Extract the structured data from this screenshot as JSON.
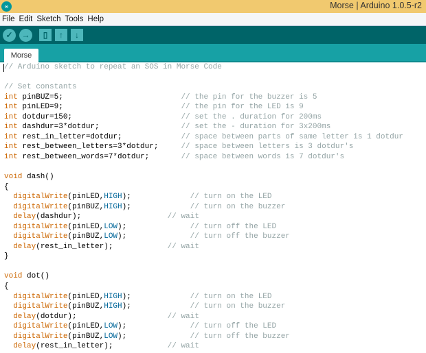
{
  "window": {
    "title": "Morse | Arduino 1.0.5-r2",
    "logo": "arduino-logo"
  },
  "menu": [
    "File",
    "Edit",
    "Sketch",
    "Tools",
    "Help"
  ],
  "toolbar": {
    "verify": "check-icon",
    "upload": "arrow-right-icon",
    "new": "new-file-icon",
    "open": "arrow-up-icon",
    "save": "arrow-down-icon"
  },
  "tabs": [
    {
      "label": "Morse"
    }
  ],
  "colors": {
    "titlebar": "#f1c96f",
    "toolbar": "#006468",
    "tabbar": "#17a1a5",
    "keyword": "#cc6600",
    "constant": "#006699",
    "comment": "#95a5a6"
  },
  "code": [
    [
      [
        "// Arduino sketch to repeat an SOS in Morse Code",
        "cm"
      ]
    ],
    [],
    [
      [
        "// Set constants",
        "cm"
      ]
    ],
    [
      [
        "int",
        "k"
      ],
      [
        " pinBUZ=5;                          "
      ],
      [
        "// the pin for the buzzer is 5",
        "cm"
      ]
    ],
    [
      [
        "int",
        "k"
      ],
      [
        " pinLED=9;                          "
      ],
      [
        "// the pin for the LED is 9",
        "cm"
      ]
    ],
    [
      [
        "int",
        "k"
      ],
      [
        " dotdur=150;                        "
      ],
      [
        "// set the . duration for 200ms",
        "cm"
      ]
    ],
    [
      [
        "int",
        "k"
      ],
      [
        " dashdur=3*dotdur;                  "
      ],
      [
        "// set the - duration for 3x200ms",
        "cm"
      ]
    ],
    [
      [
        "int",
        "k"
      ],
      [
        " rest_in_letter=dotdur;             "
      ],
      [
        "// space between parts of same letter is 1 dotdur",
        "cm"
      ]
    ],
    [
      [
        "int",
        "k"
      ],
      [
        " rest_between_letters=3*dotdur;     "
      ],
      [
        "// space between letters is 3 dotdur's",
        "cm"
      ]
    ],
    [
      [
        "int",
        "k"
      ],
      [
        " rest_between_words=7*dotdur;       "
      ],
      [
        "// space between words is 7 dotdur's",
        "cm"
      ]
    ],
    [],
    [
      [
        "void",
        "k"
      ],
      [
        " dash()"
      ]
    ],
    [
      [
        "{"
      ]
    ],
    [
      [
        "  "
      ],
      [
        "digitalWrite",
        "f"
      ],
      [
        "(pinLED,"
      ],
      [
        "HIGH",
        "c2"
      ],
      [
        ");             "
      ],
      [
        "// turn on the LED",
        "cm"
      ]
    ],
    [
      [
        "  "
      ],
      [
        "digitalWrite",
        "f"
      ],
      [
        "(pinBUZ,"
      ],
      [
        "HIGH",
        "c2"
      ],
      [
        ");             "
      ],
      [
        "// turn on the buzzer",
        "cm"
      ]
    ],
    [
      [
        "  "
      ],
      [
        "delay",
        "f"
      ],
      [
        "(dashdur);                   "
      ],
      [
        "// wait",
        "cm"
      ]
    ],
    [
      [
        "  "
      ],
      [
        "digitalWrite",
        "f"
      ],
      [
        "(pinLED,"
      ],
      [
        "LOW",
        "c2"
      ],
      [
        ");              "
      ],
      [
        "// turn off the LED",
        "cm"
      ]
    ],
    [
      [
        "  "
      ],
      [
        "digitalWrite",
        "f"
      ],
      [
        "(pinBUZ,"
      ],
      [
        "LOW",
        "c2"
      ],
      [
        ");              "
      ],
      [
        "// turn off the buzzer",
        "cm"
      ]
    ],
    [
      [
        "  "
      ],
      [
        "delay",
        "f"
      ],
      [
        "(rest_in_letter);            "
      ],
      [
        "// wait",
        "cm"
      ]
    ],
    [
      [
        "}"
      ]
    ],
    [],
    [
      [
        "void",
        "k"
      ],
      [
        " dot()"
      ]
    ],
    [
      [
        "{"
      ]
    ],
    [
      [
        "  "
      ],
      [
        "digitalWrite",
        "f"
      ],
      [
        "(pinLED,"
      ],
      [
        "HIGH",
        "c2"
      ],
      [
        ");             "
      ],
      [
        "// turn on the LED",
        "cm"
      ]
    ],
    [
      [
        "  "
      ],
      [
        "digitalWrite",
        "f"
      ],
      [
        "(pinBUZ,"
      ],
      [
        "HIGH",
        "c2"
      ],
      [
        ");             "
      ],
      [
        "// turn on the buzzer",
        "cm"
      ]
    ],
    [
      [
        "  "
      ],
      [
        "delay",
        "f"
      ],
      [
        "(dotdur);                    "
      ],
      [
        "// wait",
        "cm"
      ]
    ],
    [
      [
        "  "
      ],
      [
        "digitalWrite",
        "f"
      ],
      [
        "(pinLED,"
      ],
      [
        "LOW",
        "c2"
      ],
      [
        ");              "
      ],
      [
        "// turn off the LED",
        "cm"
      ]
    ],
    [
      [
        "  "
      ],
      [
        "digitalWrite",
        "f"
      ],
      [
        "(pinBUZ,"
      ],
      [
        "LOW",
        "c2"
      ],
      [
        ");              "
      ],
      [
        "// turn off the buzzer",
        "cm"
      ]
    ],
    [
      [
        "  "
      ],
      [
        "delay",
        "f"
      ],
      [
        "(rest_in_letter);            "
      ],
      [
        "// wait",
        "cm"
      ]
    ]
  ]
}
